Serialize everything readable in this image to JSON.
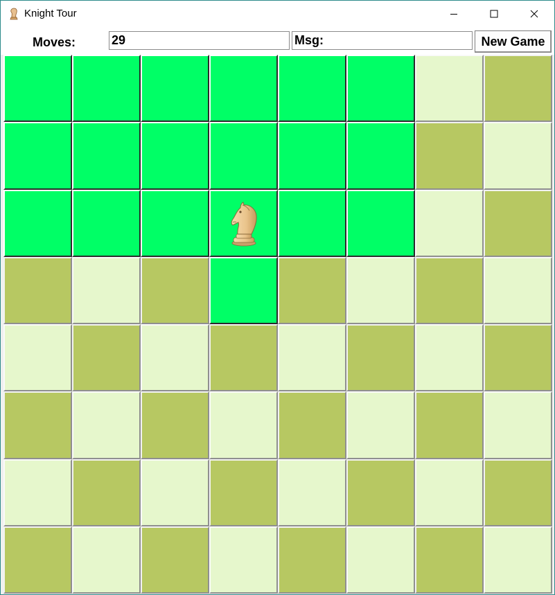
{
  "window": {
    "title": "Knight Tour"
  },
  "toolbar": {
    "moves_label": "Moves:",
    "moves_value": "29",
    "msg_value": "Msg:",
    "new_game_label": "New Game"
  },
  "board": {
    "rows": 8,
    "cols": 8,
    "colors": {
      "visited": "#00ff66",
      "light": "#e6f7cc",
      "dark": "#b7c862"
    },
    "visited": [
      [
        0,
        0
      ],
      [
        0,
        1
      ],
      [
        0,
        2
      ],
      [
        0,
        3
      ],
      [
        0,
        4
      ],
      [
        0,
        5
      ],
      [
        1,
        0
      ],
      [
        1,
        1
      ],
      [
        1,
        2
      ],
      [
        1,
        3
      ],
      [
        1,
        4
      ],
      [
        1,
        5
      ],
      [
        2,
        0
      ],
      [
        2,
        1
      ],
      [
        2,
        2
      ],
      [
        2,
        3
      ],
      [
        2,
        4
      ],
      [
        2,
        5
      ],
      [
        3,
        3
      ]
    ],
    "knight": {
      "row": 2,
      "col": 3,
      "icon": "knight-icon"
    }
  }
}
